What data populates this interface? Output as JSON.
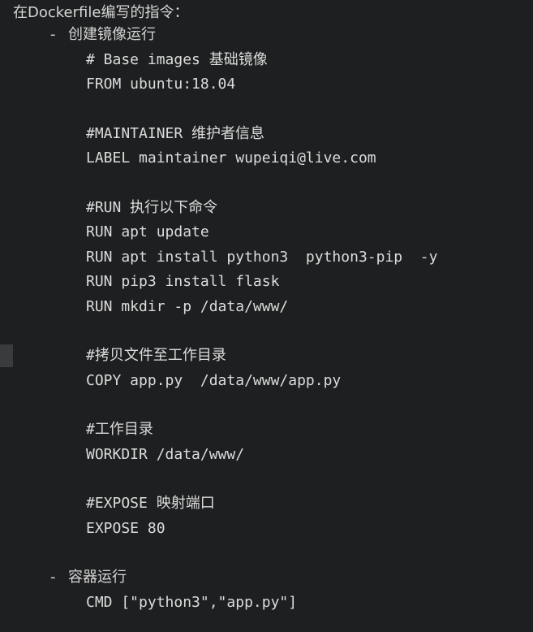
{
  "heading": "在Dockerfile编写的指令：",
  "sections": [
    {
      "dash": "-",
      "label": "创建镜像运行"
    },
    {
      "dash": "-",
      "label": "容器运行"
    }
  ],
  "code_lines": [
    "# Base images 基础镜像",
    "FROM ubuntu:18.04",
    "#MAINTAINER 维护者信息",
    "LABEL maintainer wupeiqi@live.com",
    "#RUN 执行以下命令",
    "RUN apt update",
    "RUN apt install python3  python3-pip  -y",
    "RUN pip3 install flask",
    "RUN mkdir -p /data/www/",
    "#拷贝文件至工作目录",
    "COPY app.py  /data/www/app.py",
    "#工作目录",
    "WORKDIR /data/www/",
    "#EXPOSE 映射端口",
    "EXPOSE 80",
    "CMD [\"python3\",\"app.py\"]"
  ]
}
